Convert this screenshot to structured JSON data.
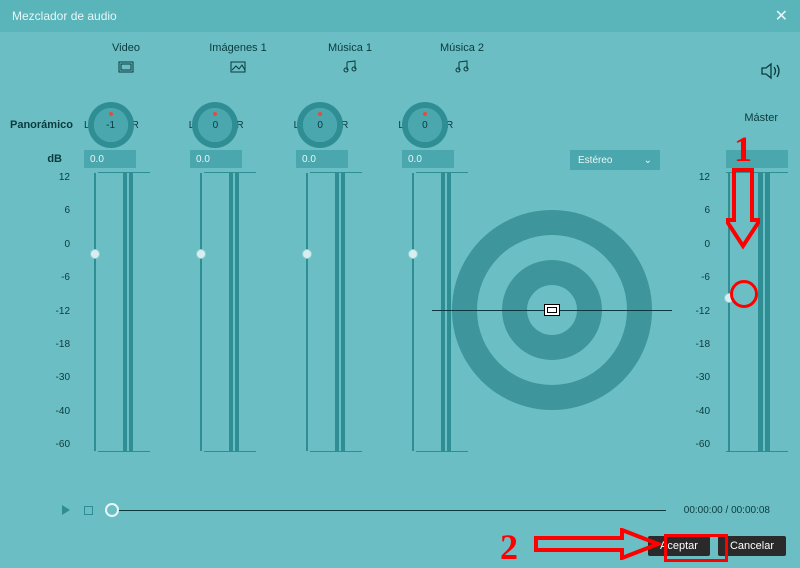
{
  "window": {
    "title": "Mezclador de audio"
  },
  "channels": [
    {
      "name": "Video",
      "icon": "video",
      "pan": "-1",
      "db": "0.0"
    },
    {
      "name": "Imágenes 1",
      "icon": "image",
      "pan": "0",
      "db": "0.0"
    },
    {
      "name": "Música 1",
      "icon": "music",
      "pan": "0",
      "db": "0.0"
    },
    {
      "name": "Música 2",
      "icon": "music",
      "pan": "0",
      "db": "0.0"
    }
  ],
  "labels": {
    "panoramic": "Panorámico",
    "L": "L",
    "R": "R",
    "dB": "dB",
    "master": "Máster"
  },
  "scale": [
    "12",
    "6",
    "0",
    "-6",
    "-12",
    "-18",
    "-30",
    "-40",
    "-60"
  ],
  "output_mode": {
    "selected": "Estéreo"
  },
  "master": {
    "db": "-6.1"
  },
  "transport": {
    "current": "00:00:00",
    "total": "00:00:08"
  },
  "buttons": {
    "accept": "Aceptar",
    "cancel": "Cancelar"
  },
  "annotations": {
    "n1": "1",
    "n2": "2"
  }
}
